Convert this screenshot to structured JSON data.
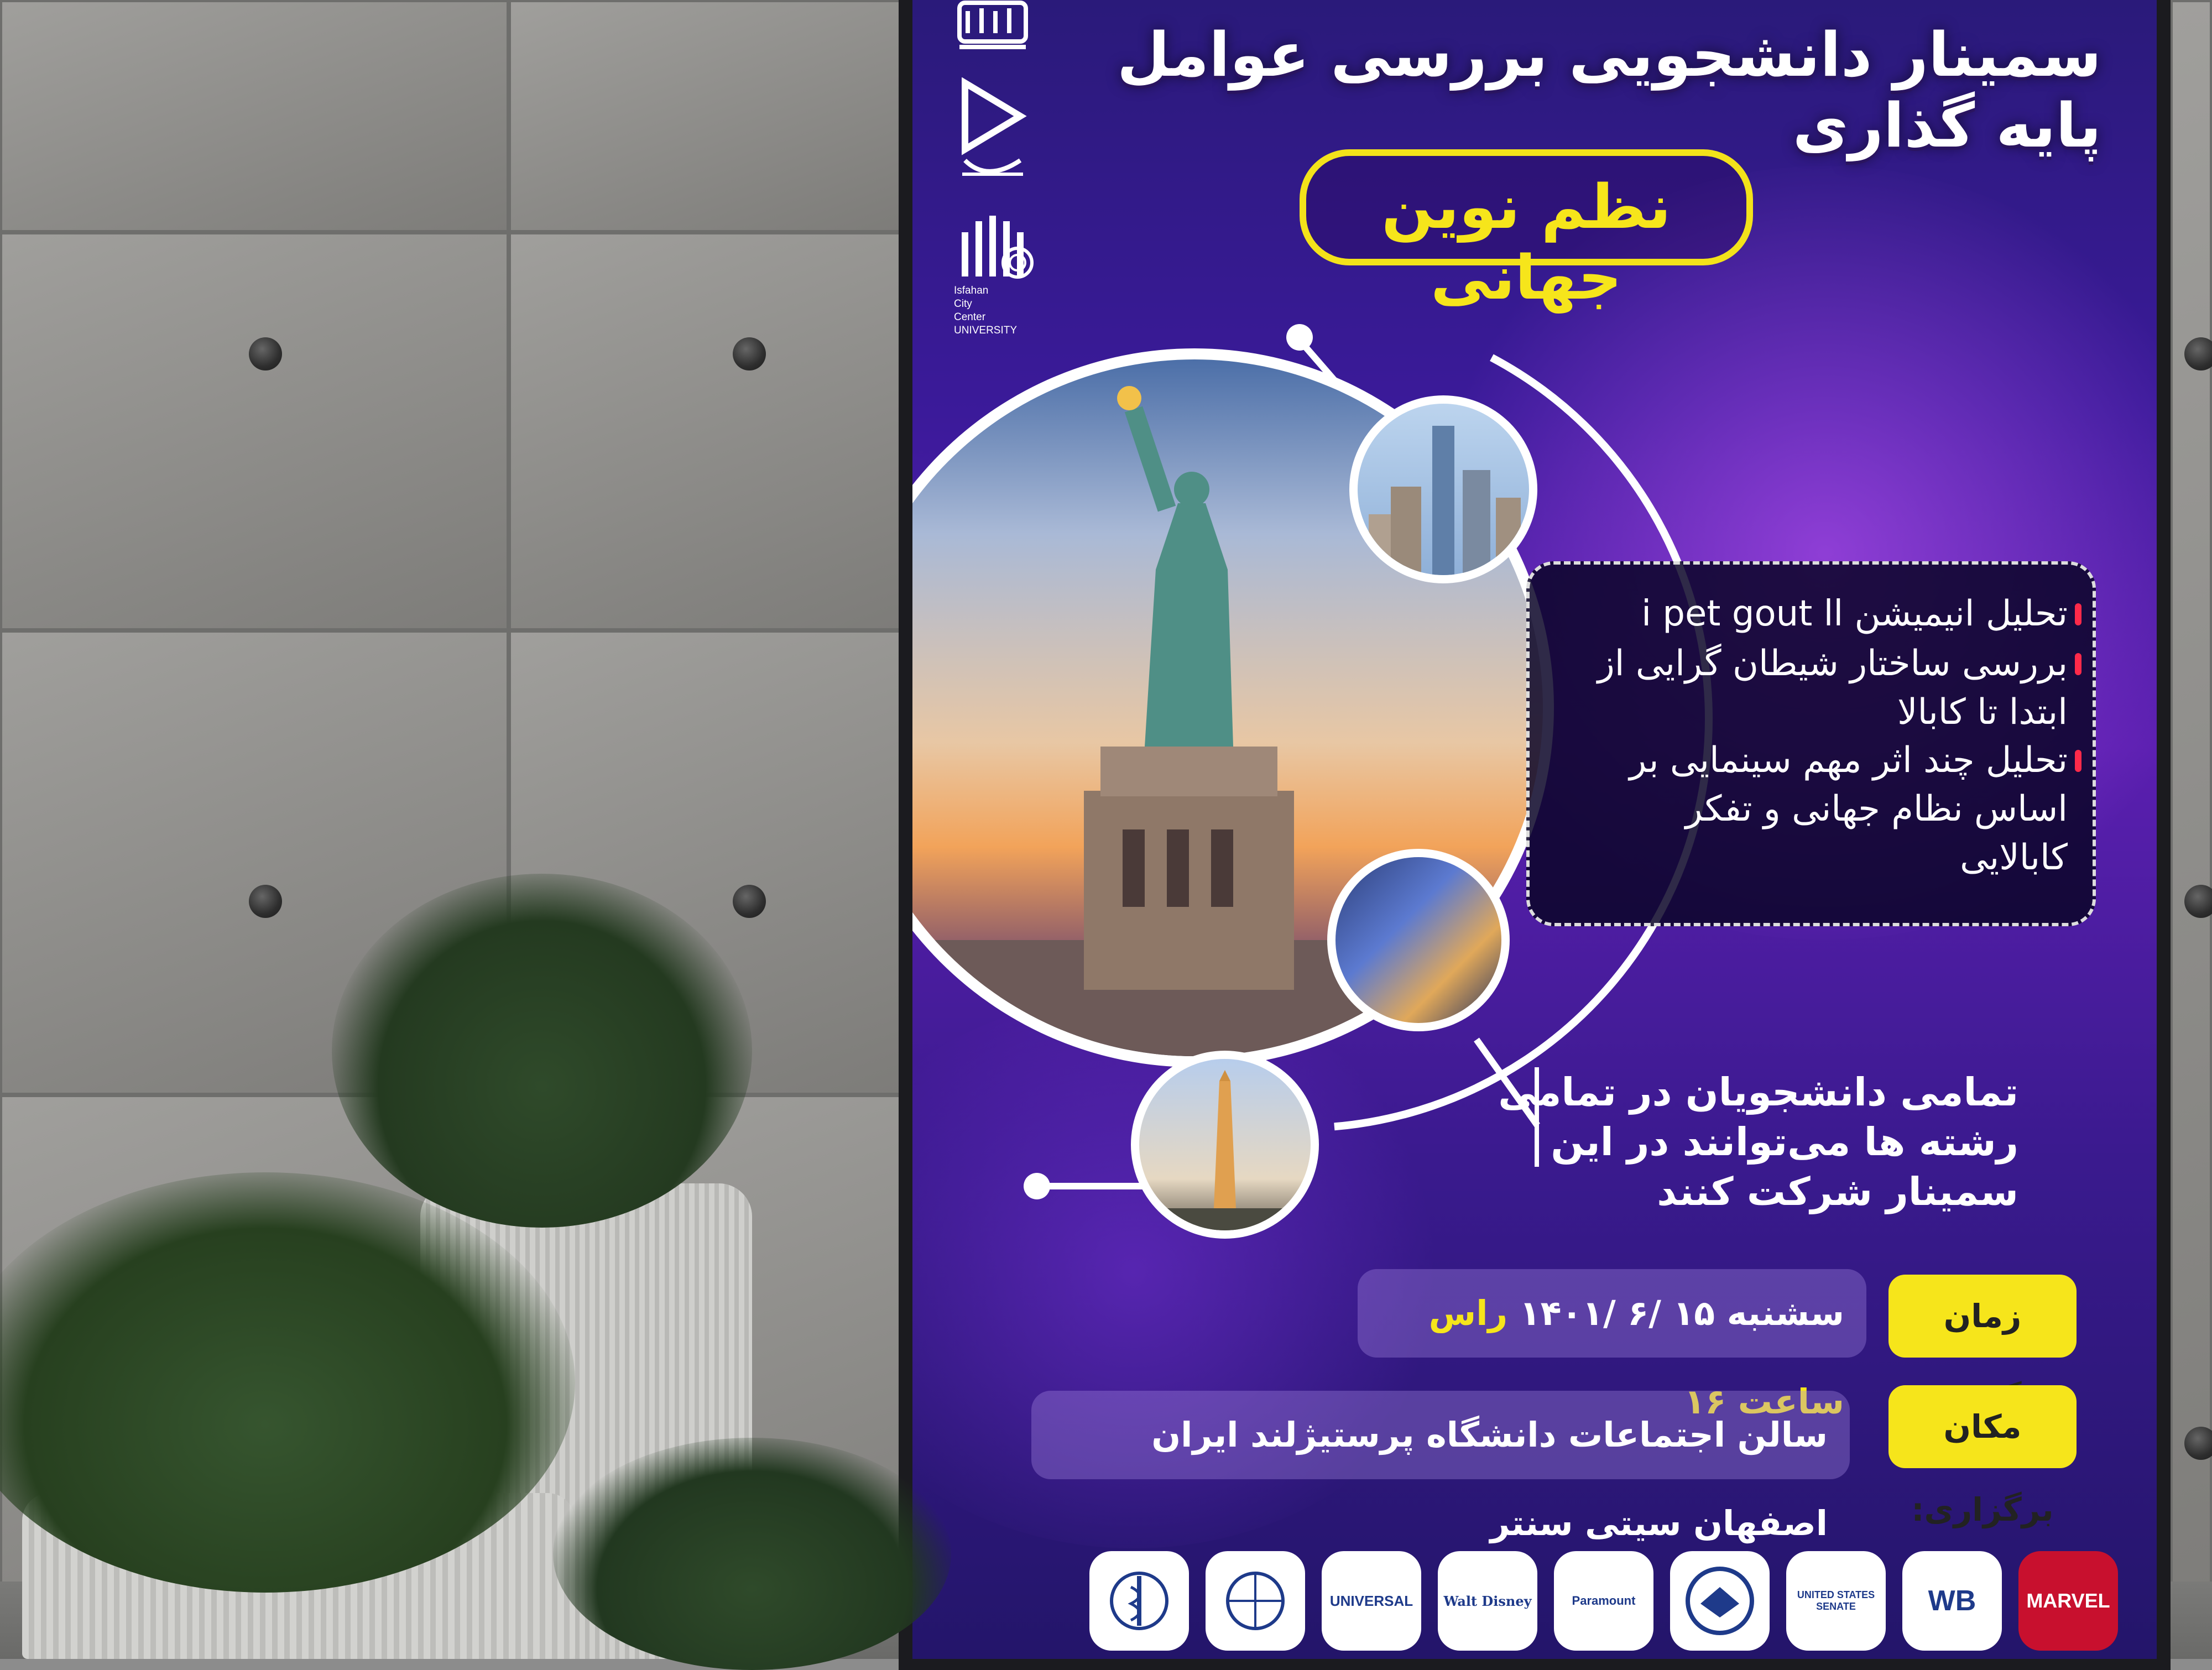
{
  "poster": {
    "title": "سمینار دانشجویی بررسی عوامل پایه گذاری",
    "subtitle": "نظم نوین جهانی",
    "bullets": [
      "تحلیل انیمیشن i pet gout ll",
      "بررسی ساختار شیطان گرایی از ابتدا تا کابالا",
      "تحلیل چند اثر مهم سینمایی بر اساس نظام جهانی و تفکر کابالایی"
    ],
    "participants": "تمامی دانشجویان در تمامی رشته ها می‌توانند در این سمینار شرکت کنند",
    "time_label": "زمان برگزاری:",
    "time_value": "سشنبه ۱۵ /۶ /۱۴۰۱",
    "time_hour": "راس ساعت ۱۶",
    "place_label": "مکان برگزاری:",
    "place_value": "سالن اجتماعات دانشگاه پرستیژلند ایران اصفهان سیتی سنتر",
    "university_logo_text": [
      "Isfahan",
      "City",
      "Center",
      "UNIVERSITY"
    ]
  },
  "sponsors": [
    "MARVEL",
    "WB",
    "UNITED STATES SENATE",
    "",
    "Paramount",
    "Walt Disney",
    "UNIVERSAL",
    "",
    ""
  ],
  "colors": {
    "poster_bg": "#3b1a9a",
    "accent_yellow": "#f6e51b",
    "bullet_red": "#ff2a4a"
  }
}
